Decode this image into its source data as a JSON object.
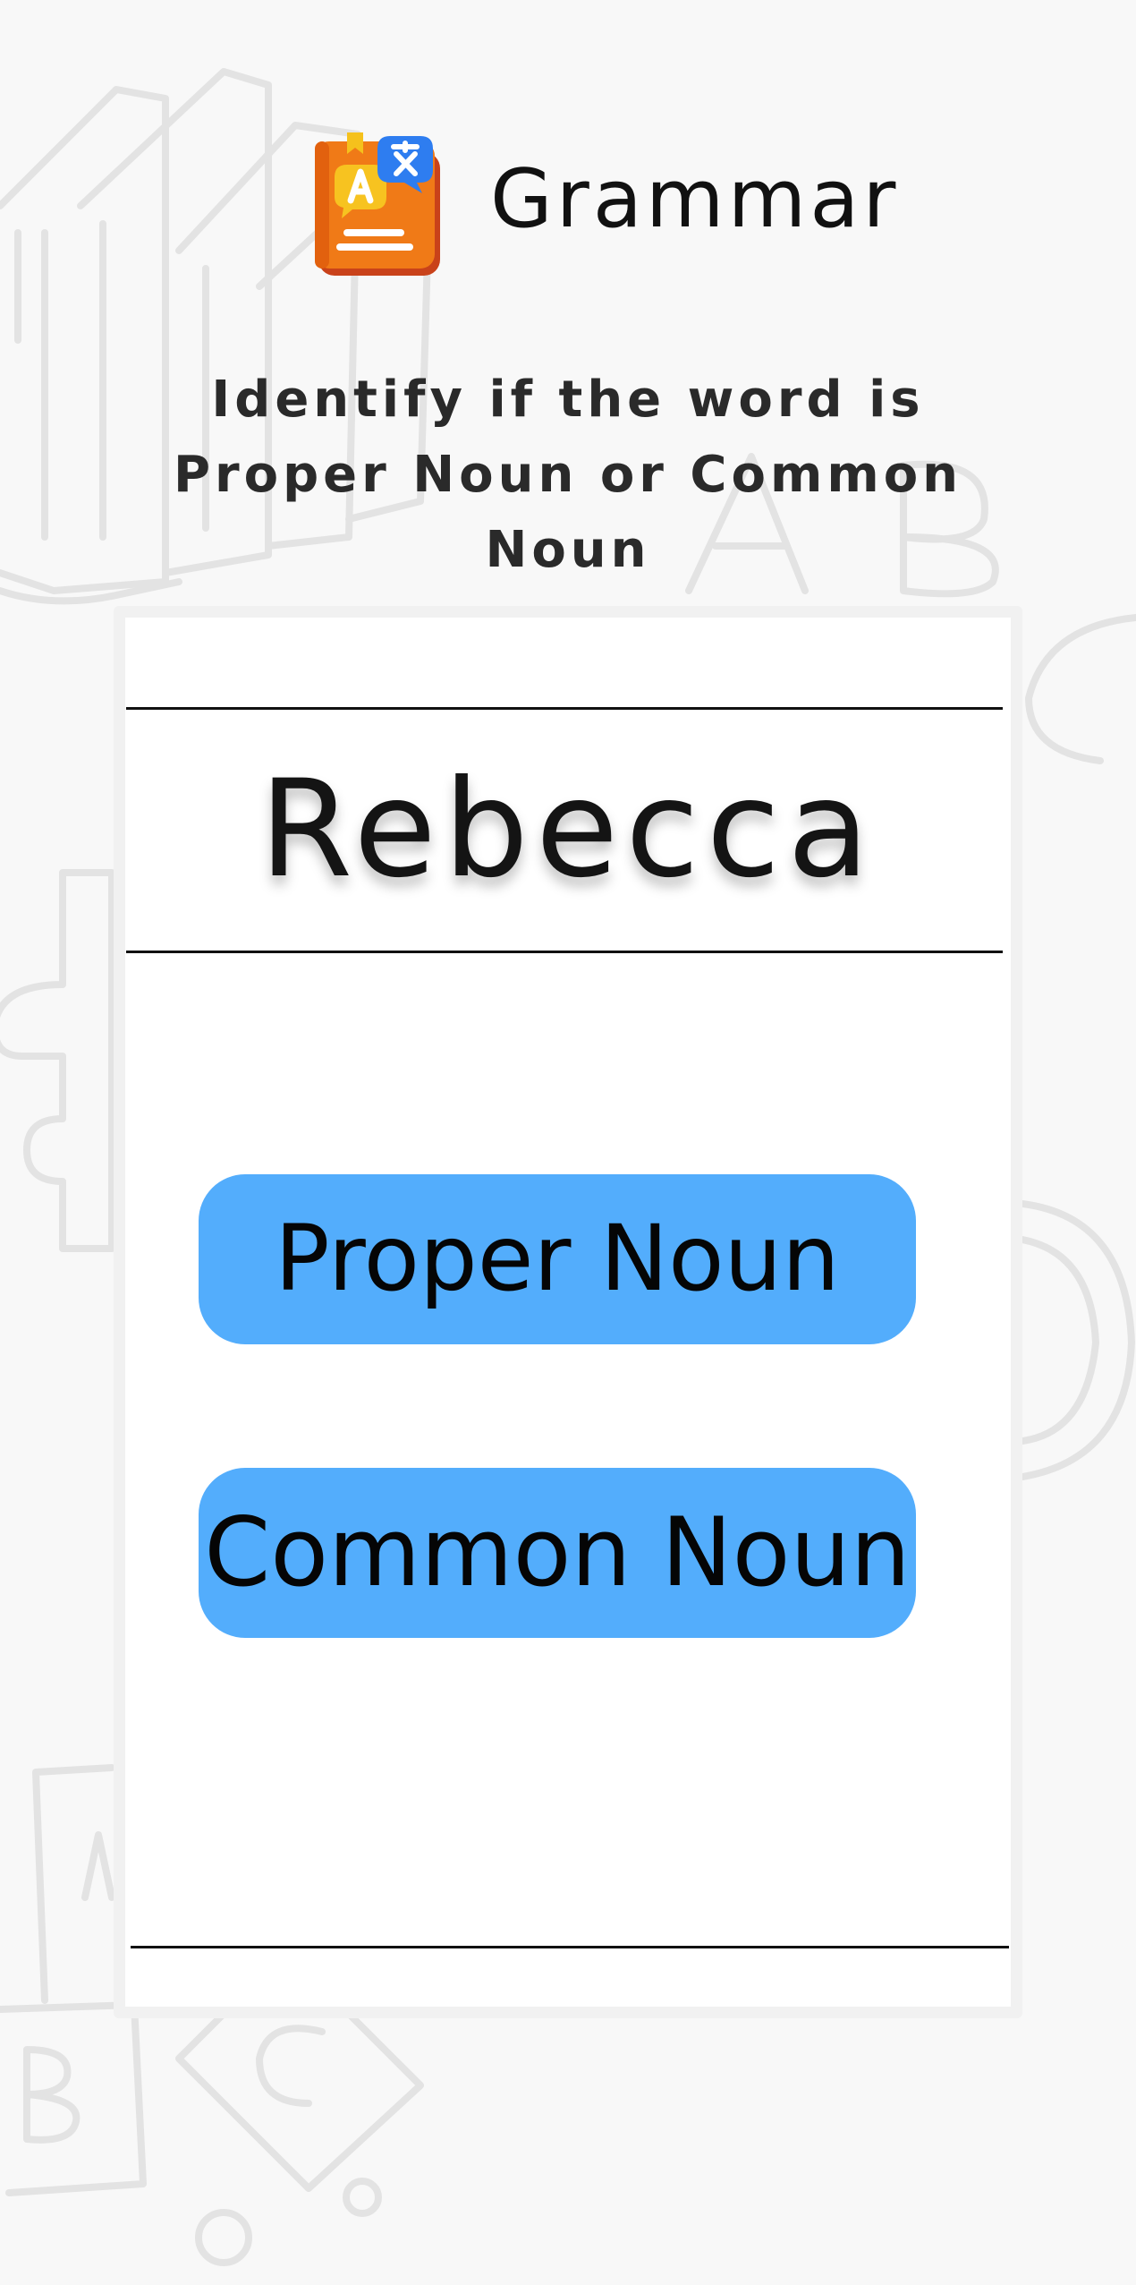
{
  "header": {
    "app_icon": "translate-book-icon",
    "title": "Grammar"
  },
  "instruction": "Identify if the word is Proper Noun or Common Noun",
  "question": {
    "word": "Rebecca"
  },
  "answers": {
    "proper_label": "Proper Noun",
    "common_label": "Common Noun"
  },
  "colors": {
    "background": "#f8f8f8",
    "card": "#ffffff",
    "button": "#53adfc",
    "text": "#111111",
    "icon_orange": "#f07a17",
    "icon_blue": "#2e7df0"
  }
}
